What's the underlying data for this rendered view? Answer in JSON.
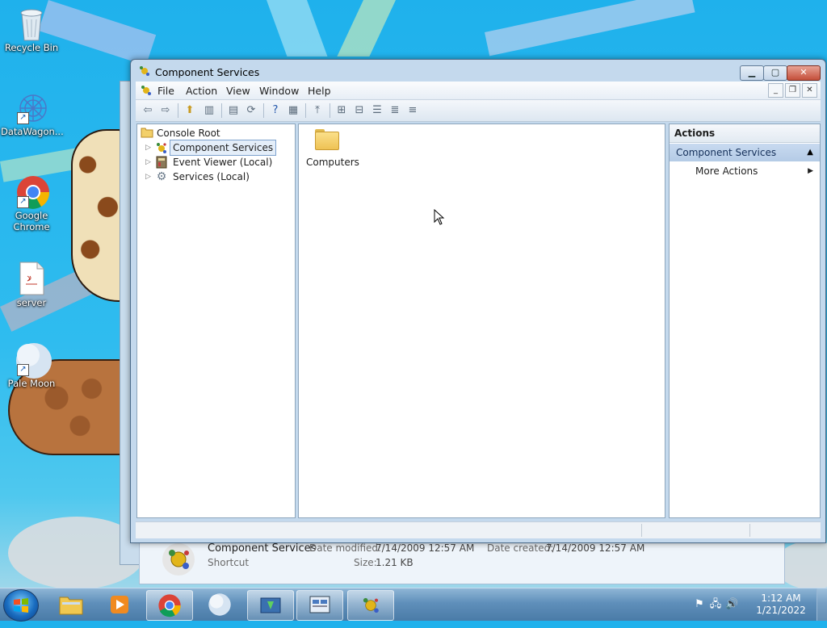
{
  "desktop": {
    "icons": [
      {
        "label": "Recycle Bin",
        "icon": "recycle-bin-icon"
      },
      {
        "label": "DataWagon...",
        "icon": "datawagon-icon"
      },
      {
        "label": "Google Chrome",
        "icon": "chrome-icon"
      },
      {
        "label": "server",
        "icon": "java-file-icon"
      },
      {
        "label": "Pale Moon",
        "icon": "pale-moon-icon"
      }
    ]
  },
  "details": {
    "name": "Component Services",
    "type": "Shortcut",
    "date_modified_label": "Date modified:",
    "date_modified": "7/14/2009 12:57 AM",
    "date_created_label": "Date created:",
    "date_created": "7/14/2009 12:57 AM",
    "size_label": "Size:",
    "size": "1.21 KB"
  },
  "window": {
    "title": "Component Services",
    "menu": [
      "File",
      "Action",
      "View",
      "Window",
      "Help"
    ],
    "tree": [
      {
        "label": "Console Root",
        "icon": "folder-icon"
      },
      {
        "label": "Component Services",
        "icon": "component-services-icon"
      },
      {
        "label": "Event Viewer (Local)",
        "icon": "event-viewer-icon"
      },
      {
        "label": "Services (Local)",
        "icon": "services-icon"
      }
    ],
    "list_items": [
      {
        "label": "Computers",
        "icon": "folder-icon"
      }
    ],
    "actions": {
      "header": "Actions",
      "section": "Component Services",
      "items": [
        "More Actions"
      ]
    }
  },
  "taskbar": {
    "clock_time": "1:12 AM",
    "clock_date": "1/21/2022"
  }
}
